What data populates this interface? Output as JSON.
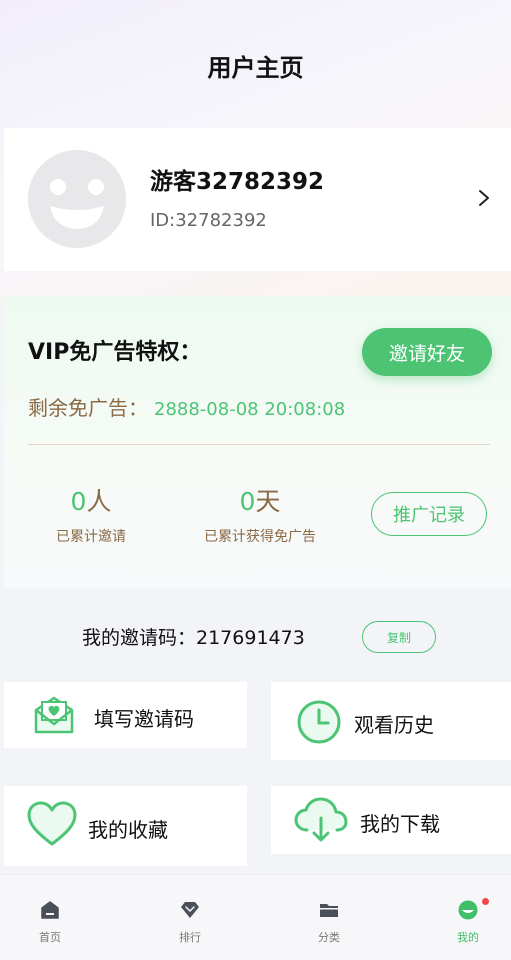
{
  "header": {
    "title": "用户主页"
  },
  "profile": {
    "username": "游客32782392",
    "user_id": "ID:32782392",
    "avatar_icon": "smiley-avatar-icon",
    "arrow_icon": "chevron-right-icon"
  },
  "vip": {
    "title": "VIP免广告特权：",
    "invite_button": "邀请好友",
    "remain_label": "剩余免广告：",
    "remain_value": "2888-08-08 20:08:08",
    "invites_count": "0",
    "invites_unit": "人",
    "invites_label": "已累计邀请",
    "adfree_days": "0",
    "adfree_unit": "天",
    "adfree_label": "已累计获得免广告",
    "promo_button": "推广记录"
  },
  "invite_code": {
    "label": "我的邀请码：217691473",
    "copy_button": "复制"
  },
  "menu": [
    {
      "label": "填写邀请码",
      "icon": "mail-heart-icon"
    },
    {
      "label": "观看历史",
      "icon": "clock-icon"
    },
    {
      "label": "我的收藏",
      "icon": "heart-icon"
    },
    {
      "label": "我的下载",
      "icon": "cloud-download-icon"
    }
  ],
  "nav": [
    {
      "label": "首页",
      "icon": "home-icon",
      "active": false
    },
    {
      "label": "排行",
      "icon": "ranking-diamond-icon",
      "active": false
    },
    {
      "label": "分类",
      "icon": "folder-icon",
      "active": false
    },
    {
      "label": "我的",
      "icon": "profile-smile-icon",
      "active": true
    }
  ],
  "colors": {
    "accent": "#4cc474",
    "brown": "#8b6a46",
    "badge": "#f24848"
  }
}
